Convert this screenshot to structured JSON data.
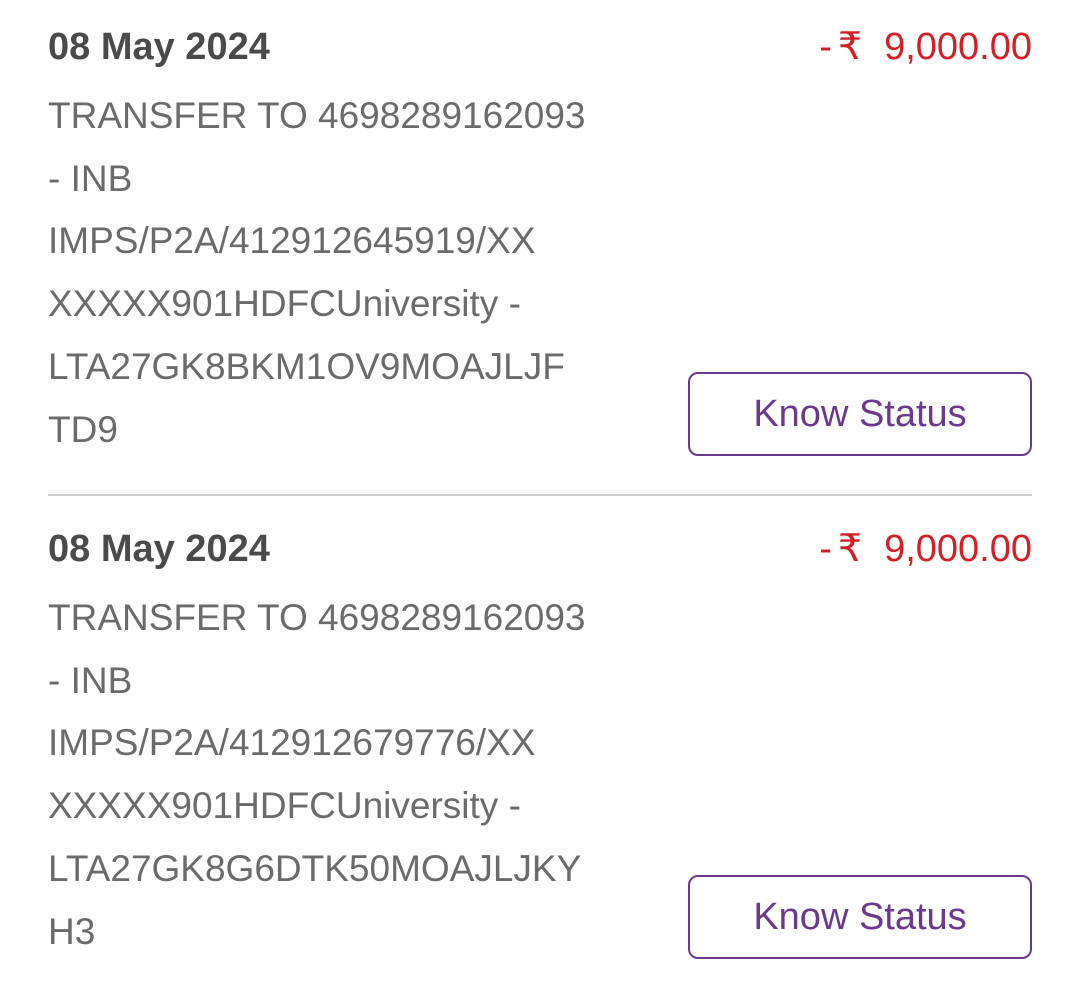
{
  "transactions": [
    {
      "date": "08 May 2024",
      "amount": {
        "sign": "-",
        "currency": "₹",
        "value": "9,000.00"
      },
      "description_lines": [
        "TRANSFER TO 4698289162093",
        "- INB",
        "IMPS/P2A/412912645919/XX",
        "XXXXX901HDFCUniversity -",
        "LTA27GK8BKM1OV9MOAJLJF",
        "TD9"
      ],
      "action_label": "Know Status"
    },
    {
      "date": "08 May 2024",
      "amount": {
        "sign": "-",
        "currency": "₹",
        "value": "9,000.00"
      },
      "description_lines": [
        "TRANSFER TO 4698289162093",
        "- INB",
        "IMPS/P2A/412912679776/XX",
        "XXXXX901HDFCUniversity -",
        "LTA27GK8G6DTK50MOAJLJKY",
        "H3"
      ],
      "action_label": "Know Status"
    }
  ],
  "colors": {
    "debit_amount": "#d32027",
    "accent": "#6b3a8f",
    "date_text": "#4a4a4a",
    "description_text": "#6b6b6b",
    "divider": "#cccccc"
  }
}
